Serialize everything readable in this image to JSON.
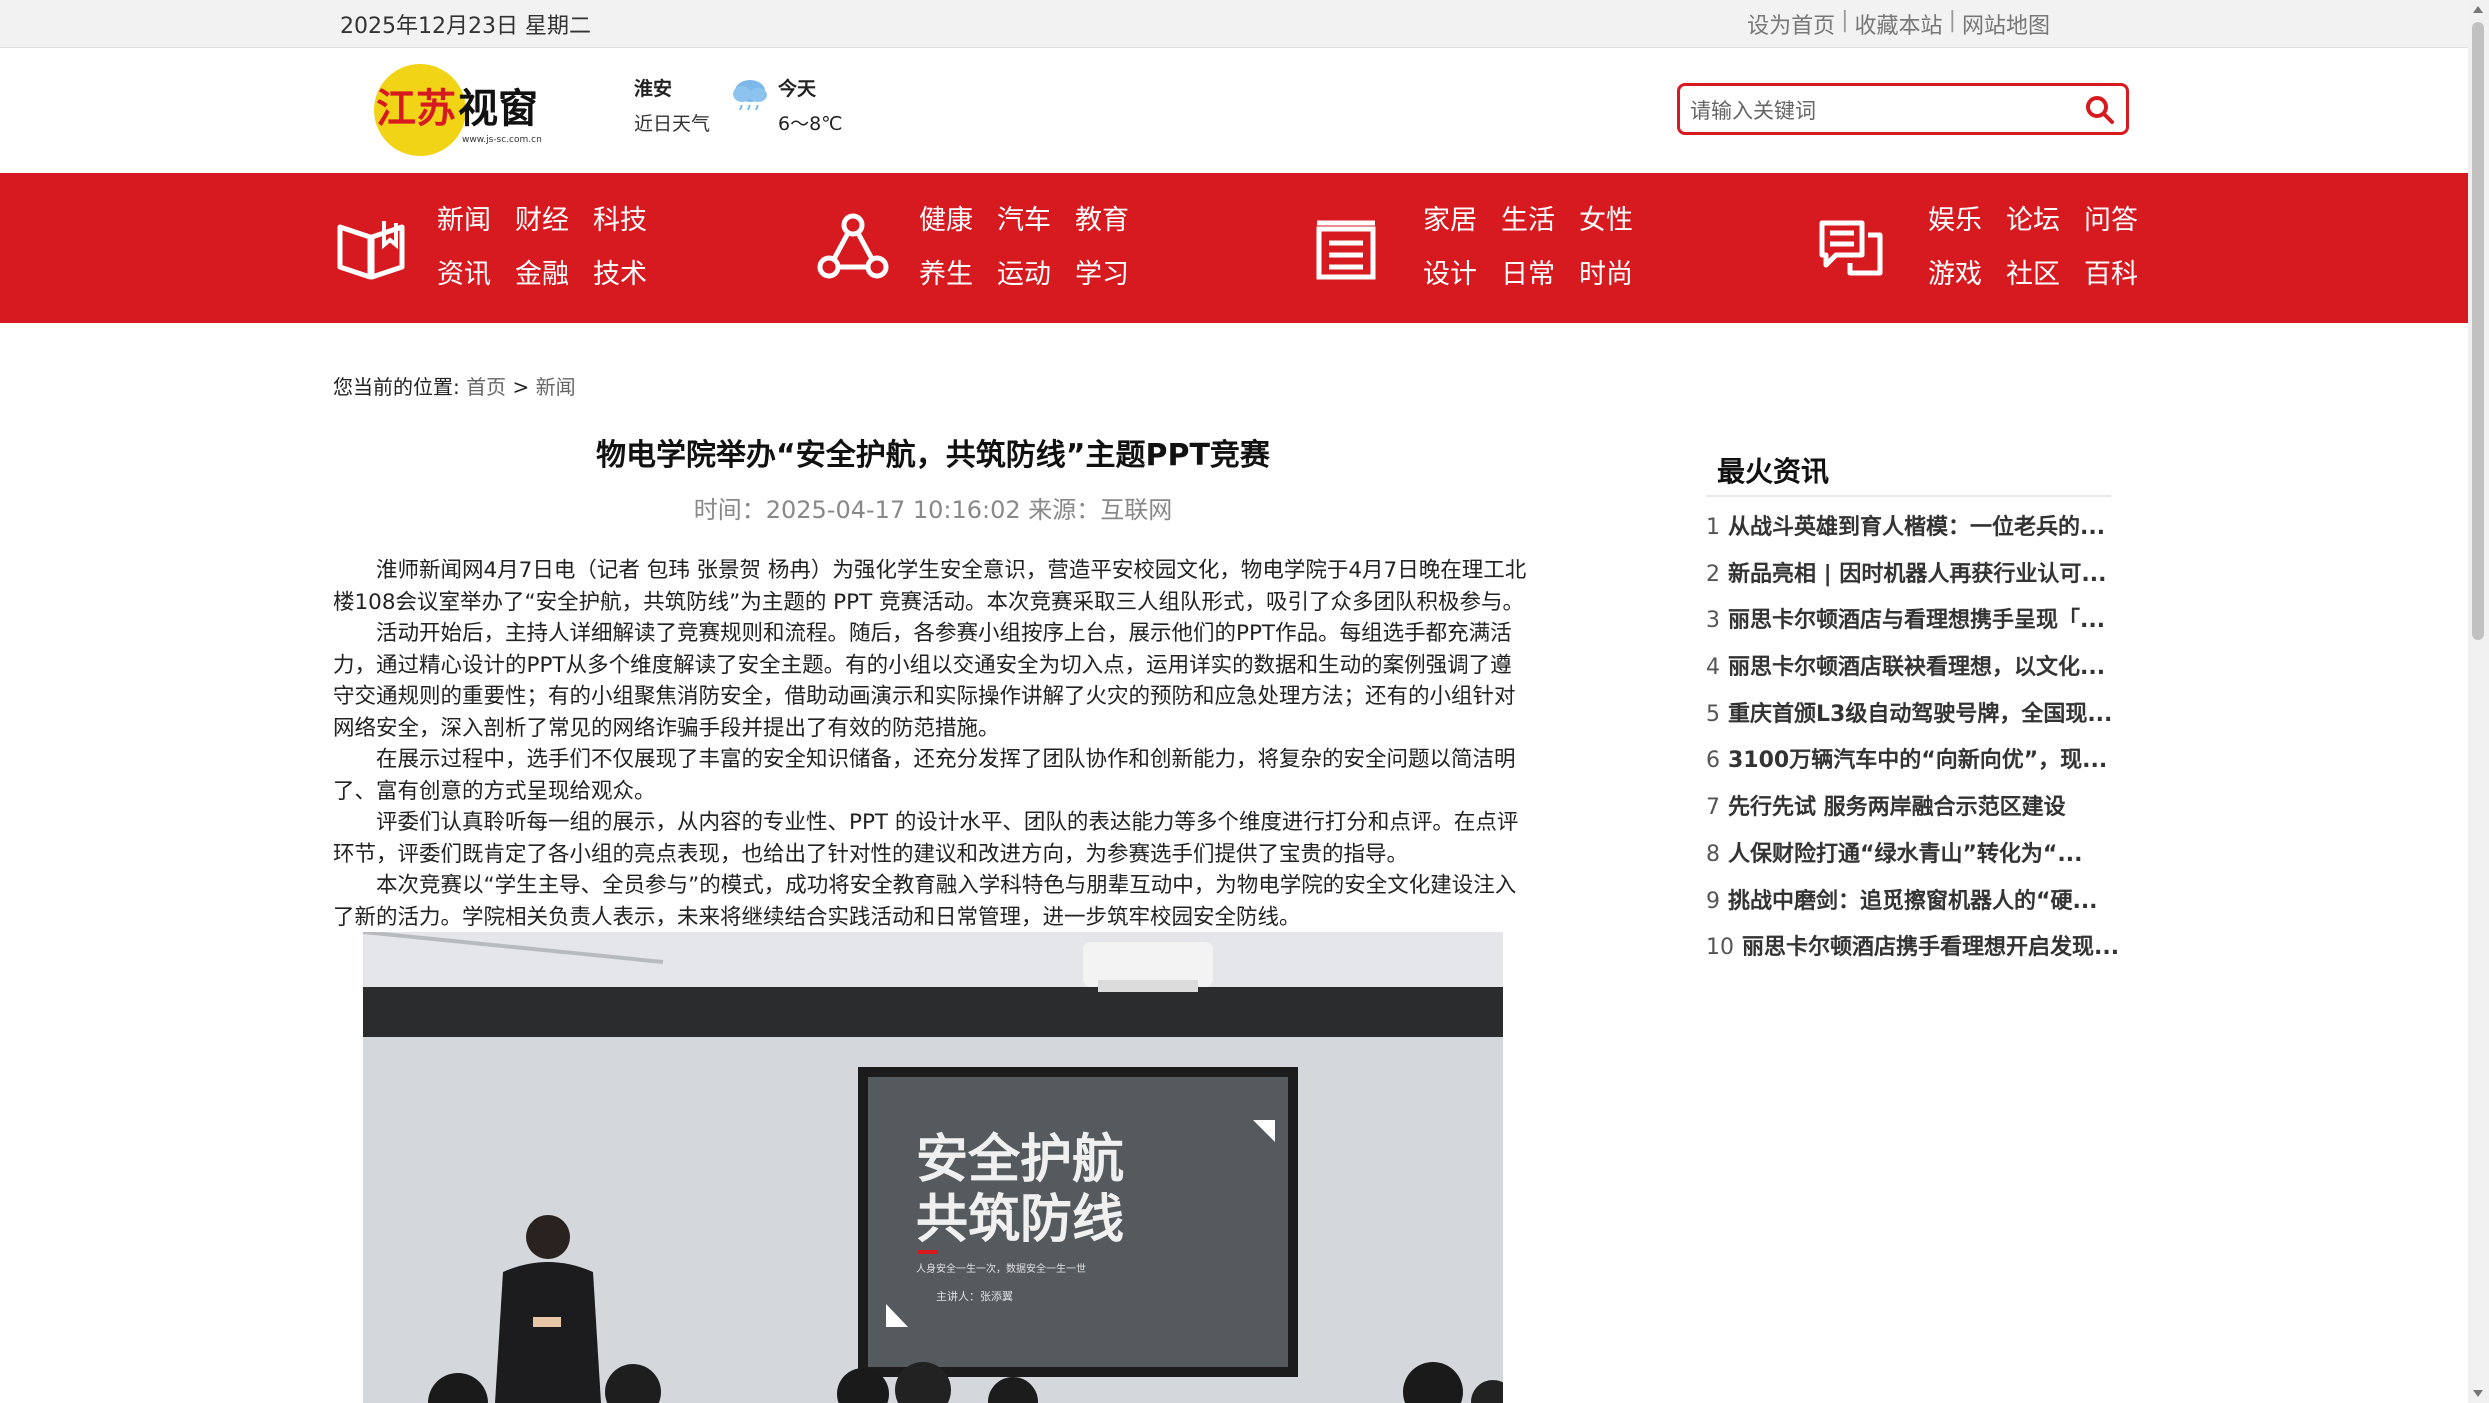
{
  "topbar": {
    "date": "2025年12月23日 星期二",
    "links": [
      "设为首页",
      "收藏本站",
      "网站地图"
    ],
    "separator": "|"
  },
  "logo": {
    "text": "江苏视窗",
    "url_text": "www.js-sc.com.cn"
  },
  "weather": {
    "city": "淮安",
    "label": "近日天气",
    "today": "今天",
    "temp": "6～8℃",
    "icon": "rain-cloud-icon"
  },
  "search": {
    "placeholder": "请输入关键词",
    "icon": "search-icon"
  },
  "nav": {
    "groups": [
      {
        "icon": "open-book-icon",
        "items": [
          "新闻",
          "财经",
          "科技",
          "资讯",
          "金融",
          "技术"
        ]
      },
      {
        "icon": "triangle-network-icon",
        "items": [
          "健康",
          "汽车",
          "教育",
          "养生",
          "运动",
          "学习"
        ]
      },
      {
        "icon": "document-tray-icon",
        "items": [
          "家居",
          "生活",
          "女性",
          "设计",
          "日常",
          "时尚"
        ]
      },
      {
        "icon": "chat-list-icon",
        "items": [
          "娱乐",
          "论坛",
          "问答",
          "游戏",
          "社区",
          "百科"
        ]
      }
    ]
  },
  "breadcrumb": {
    "label": "您当前的位置:",
    "home": "首页",
    "sep": " > ",
    "current": "新闻"
  },
  "article": {
    "title": "物电学院举办“安全护航，共筑防线”主题PPT竞赛",
    "meta": "时间：2025-04-17 10:16:02 来源：互联网",
    "paragraphs": [
      "淮师新闻网4月7日电（记者 包玮 张景贺 杨冉）为强化学生安全意识，营造平安校园文化，物电学院于4月7日晚在理工北楼108会议室举办了“安全护航，共筑防线”为主题的 PPT 竞赛活动。本次竞赛采取三人组队形式，吸引了众多团队积极参与。",
      "活动开始后，主持人详细解读了竞赛规则和流程。随后，各参赛小组按序上台，展示他们的PPT作品。每组选手都充满活力，通过精心设计的PPT从多个维度解读了安全主题。有的小组以交通安全为切入点，运用详实的数据和生动的案例强调了遵守交通规则的重要性；有的小组聚焦消防安全，借助动画演示和实际操作讲解了火灾的预防和应急处理方法；还有的小组针对网络安全，深入剖析了常见的网络诈骗手段并提出了有效的防范措施。",
      "在展示过程中，选手们不仅展现了丰富的安全知识储备，还充分发挥了团队协作和创新能力，将复杂的安全问题以简洁明了、富有创意的方式呈现给观众。",
      "评委们认真聆听每一组的展示，从内容的专业性、PPT 的设计水平、团队的表达能力等多个维度进行打分和点评。在点评环节，评委们既肯定了各小组的亮点表现，也给出了针对性的建议和改进方向，为参赛选手们提供了宝贵的指导。",
      "本次竞赛以“学生主导、全员参与”的模式，成功将安全教育融入学科特色与朋辈互动中，为物电学院的安全文化建设注入了新的活力。学院相关负责人表示，未来将继续结合实践活动和日常管理，进一步筑牢校园安全防线。"
    ],
    "photo": {
      "slide_line1": "安全护航",
      "slide_line2": "共筑防线",
      "slide_sub": "人身安全一生一次，数据安全一生一世",
      "slide_presenter": "主讲人：张添翼"
    }
  },
  "sidebar": {
    "title": "最火资讯",
    "items": [
      {
        "num": "1",
        "text": "从战斗英雄到育人楷模：一位老兵的..."
      },
      {
        "num": "2",
        "text": "新品亮相 | 因时机器人再获行业认可..."
      },
      {
        "num": "3",
        "text": "丽思卡尔顿酒店与看理想携手呈现「..."
      },
      {
        "num": "4",
        "text": "丽思卡尔顿酒店联袂看理想，以文化..."
      },
      {
        "num": "5",
        "text": "重庆首颁L3级自动驾驶号牌，全国现..."
      },
      {
        "num": "6",
        "text": "3100万辆汽车中的“向新向优”，现..."
      },
      {
        "num": "7",
        "text": "先行先试 服务两岸融合示范区建设"
      },
      {
        "num": "8",
        "text": "人保财险打通“绿水青山”转化为“..."
      },
      {
        "num": "9",
        "text": "挑战中磨剑：追觅擦窗机器人的“硬..."
      },
      {
        "num": "10",
        "text": "丽思卡尔顿酒店携手看理想开启发现..."
      }
    ]
  },
  "colors": {
    "brand_red": "#d71920",
    "logo_yellow": "#f2d417",
    "topbar_bg": "#f2f2f2"
  }
}
